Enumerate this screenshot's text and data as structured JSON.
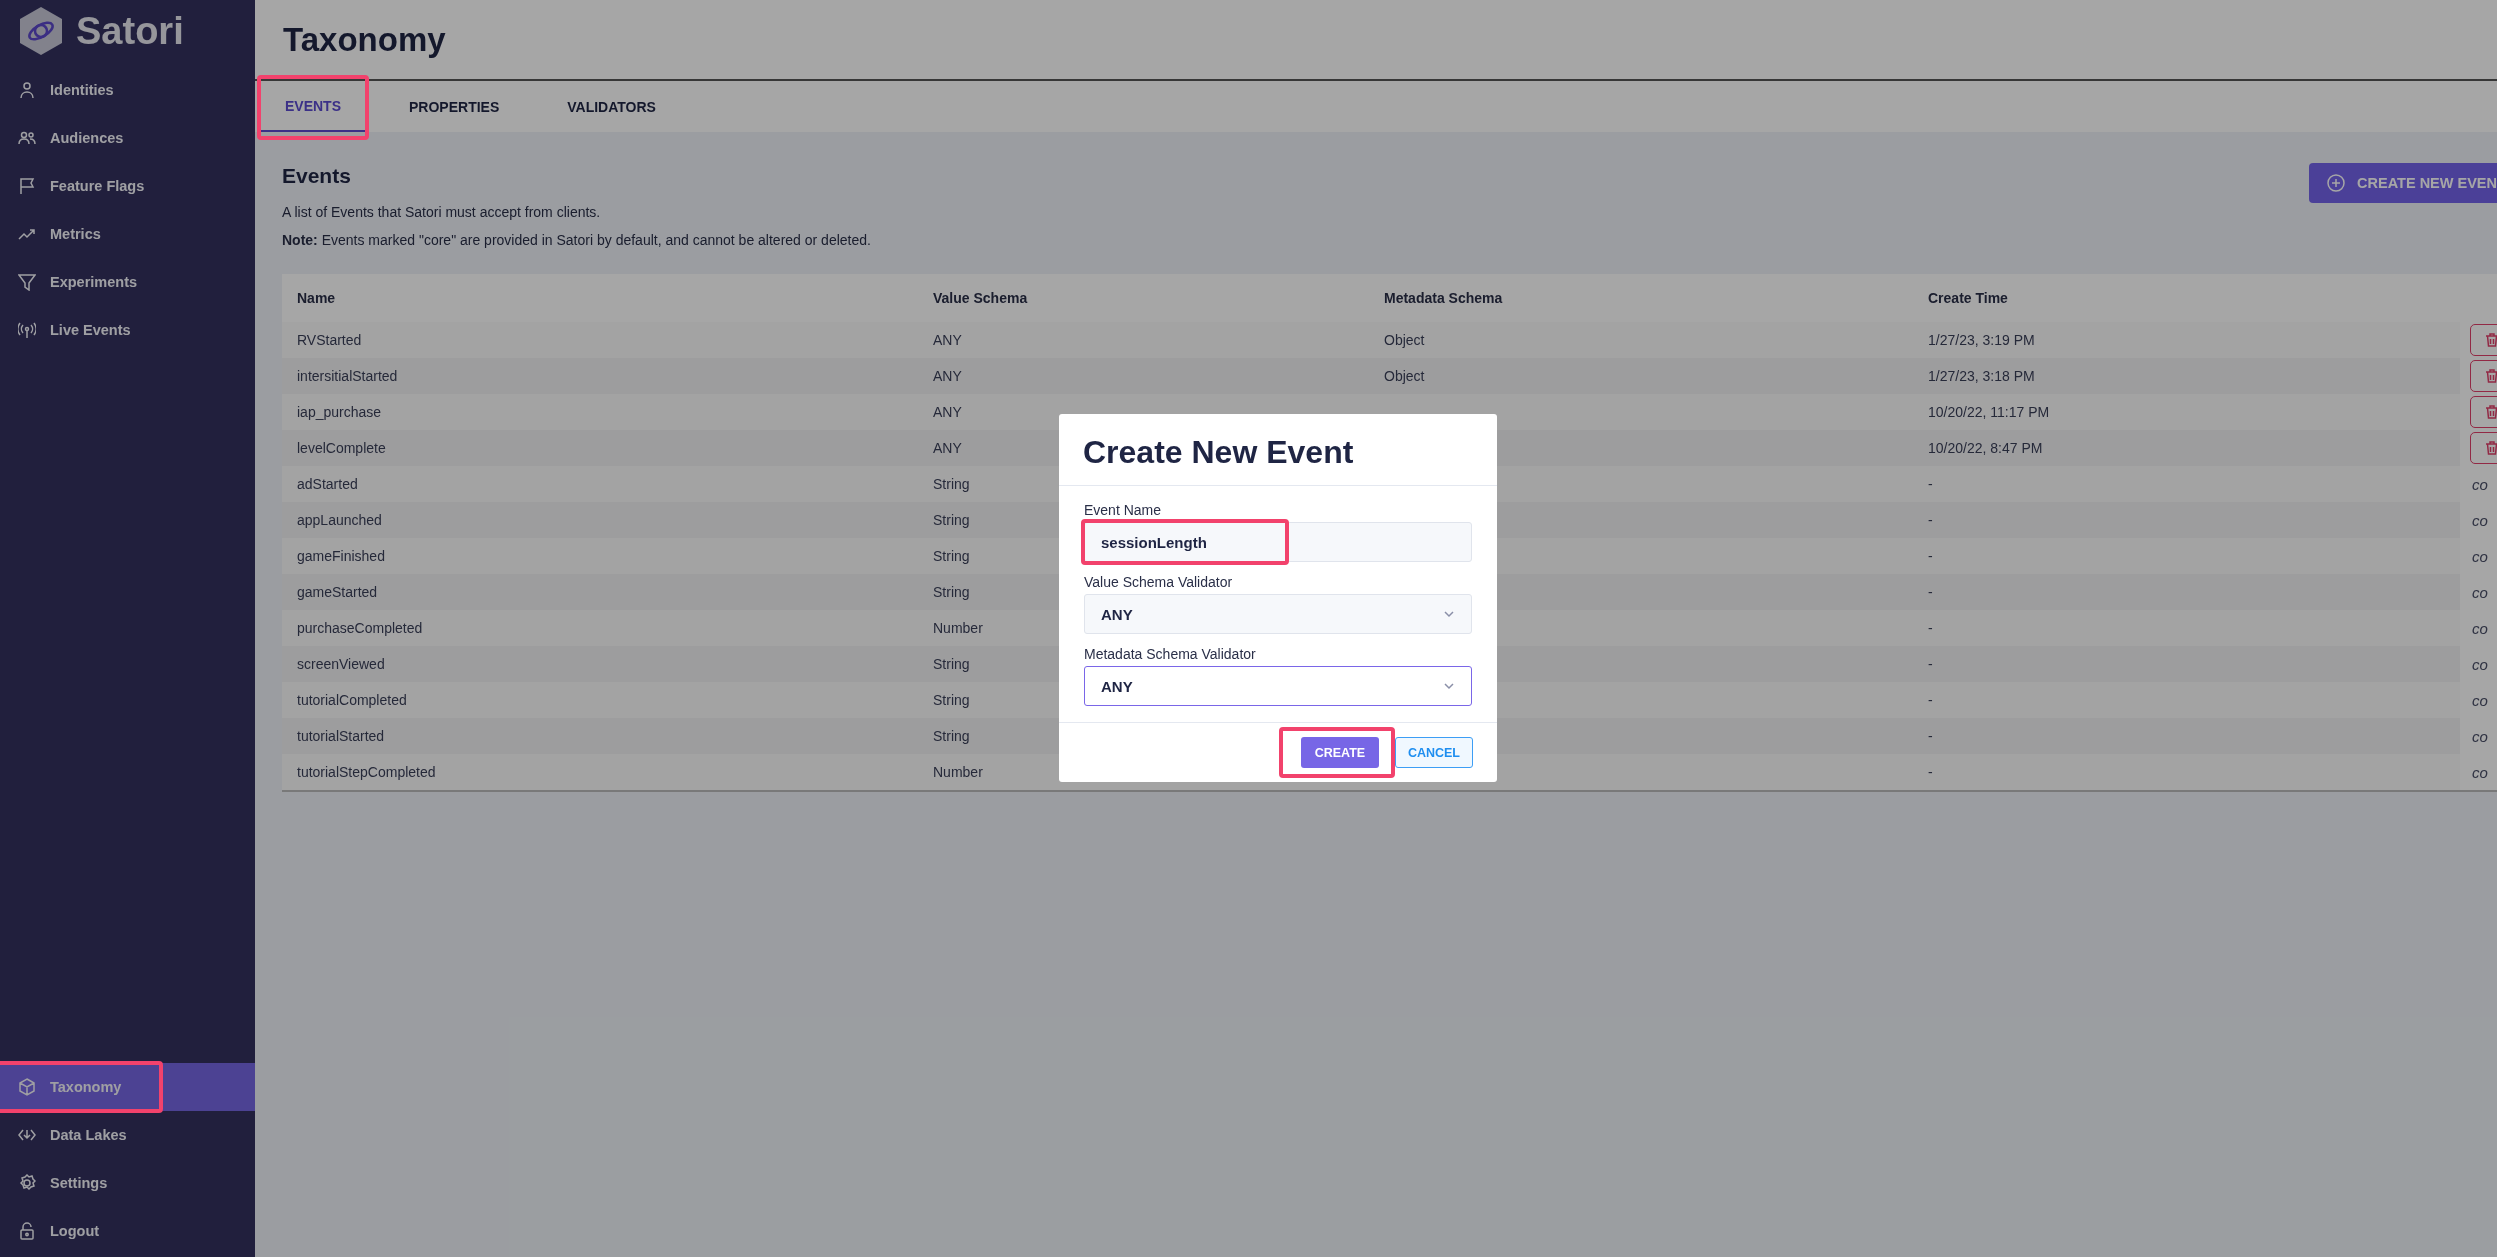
{
  "sidebar": {
    "brand": "Satori",
    "items": [
      {
        "label": "Identities",
        "selected": false,
        "highlighted": false
      },
      {
        "label": "Audiences",
        "selected": false,
        "highlighted": false
      },
      {
        "label": "Feature Flags",
        "selected": false,
        "highlighted": false
      },
      {
        "label": "Metrics",
        "selected": false,
        "highlighted": false
      },
      {
        "label": "Experiments",
        "selected": false,
        "highlighted": false
      },
      {
        "label": "Live Events",
        "selected": false,
        "highlighted": false
      }
    ],
    "bottom_items": [
      {
        "label": "Taxonomy",
        "selected": true,
        "highlighted": true
      },
      {
        "label": "Data Lakes",
        "selected": false,
        "highlighted": false
      },
      {
        "label": "Settings",
        "selected": false,
        "highlighted": false
      },
      {
        "label": "Logout",
        "selected": false,
        "highlighted": false
      }
    ]
  },
  "page": {
    "title": "Taxonomy",
    "tabs": [
      {
        "label": "EVENTS",
        "selected": true,
        "highlighted": true
      },
      {
        "label": "PROPERTIES",
        "selected": false,
        "highlighted": false
      },
      {
        "label": "VALIDATORS",
        "selected": false,
        "highlighted": false
      }
    ],
    "section": {
      "heading": "Events",
      "description": "A list of Events that Satori must accept from clients.",
      "note": "**Note:** Events marked \"core\" are provided in Satori by default, and cannot be altered or deleted.",
      "create_button": "CREATE NEW EVEN"
    },
    "table": {
      "columns": [
        "Name",
        "Value Schema",
        "Metadata Schema",
        "Create Time"
      ],
      "rows": [
        {
          "kind": "deletable",
          "name": "RVStarted",
          "value_schema": "ANY",
          "metadata_schema": "Object",
          "create_time": "1/27/23, 3:19 PM"
        },
        {
          "kind": "deletable",
          "name": "intersitialStarted",
          "value_schema": "ANY",
          "metadata_schema": "Object",
          "create_time": "1/27/23, 3:18 PM"
        },
        {
          "kind": "deletable",
          "name": "iap_purchase",
          "value_schema": "ANY",
          "create_time": "10/20/22, 11:17 PM"
        },
        {
          "kind": "deletable",
          "name": "levelComplete",
          "value_schema": "ANY",
          "create_time": "10/20/22, 8:47 PM"
        },
        {
          "kind": "core",
          "name": "adStarted",
          "value_schema": "String",
          "create_time": "-",
          "tag": "co"
        },
        {
          "kind": "core",
          "name": "appLaunched",
          "value_schema": "String",
          "create_time": "-",
          "tag": "co"
        },
        {
          "kind": "core",
          "name": "gameFinished",
          "value_schema": "String",
          "create_time": "-",
          "tag": "co"
        },
        {
          "kind": "core",
          "name": "gameStarted",
          "value_schema": "String",
          "create_time": "-",
          "tag": "co"
        },
        {
          "kind": "core",
          "name": "purchaseCompleted",
          "value_schema": "Number",
          "create_time": "-",
          "tag": "co"
        },
        {
          "kind": "core",
          "name": "screenViewed",
          "value_schema": "String",
          "create_time": "-",
          "tag": "co"
        },
        {
          "kind": "core",
          "name": "tutorialCompleted",
          "value_schema": "String",
          "create_time": "-",
          "tag": "co"
        },
        {
          "kind": "core",
          "name": "tutorialStarted",
          "value_schema": "String",
          "create_time": "-",
          "tag": "co"
        },
        {
          "kind": "core",
          "name": "tutorialStepCompleted",
          "value_schema": "Number",
          "create_time": "-",
          "tag": "co"
        }
      ]
    }
  },
  "modal": {
    "title": "Create New Event",
    "fields": [
      {
        "kind": "text",
        "label": "Event Name",
        "value": "sessionLength",
        "focused": false,
        "highlighted": true
      },
      {
        "kind": "select",
        "label": "Value Schema Validator",
        "value": "ANY",
        "focused": false,
        "highlighted": false
      },
      {
        "kind": "select",
        "label": "Metadata Schema Validator",
        "value": "ANY",
        "focused": true,
        "highlighted": false
      }
    ],
    "buttons": [
      {
        "kind": "primary",
        "label": "CREATE",
        "highlighted": true
      },
      {
        "kind": "secondary",
        "label": "CANCEL"
      }
    ]
  }
}
